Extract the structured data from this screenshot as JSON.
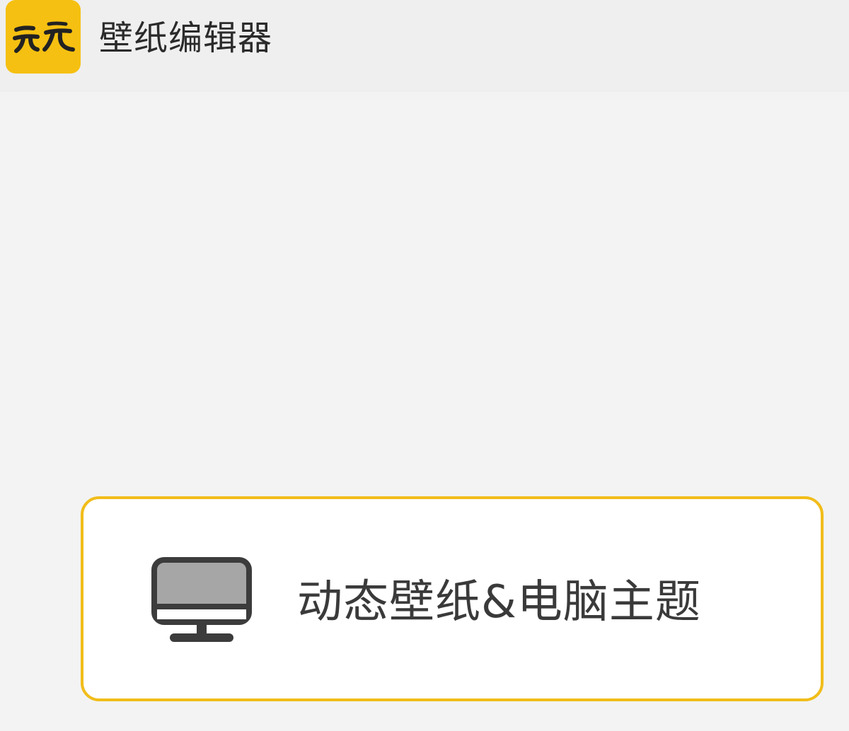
{
  "app": {
    "logo_text": "元气",
    "title": "壁纸编辑器",
    "brand_color": "#f5c011"
  },
  "card": {
    "icon": "monitor-icon",
    "label": "动态壁纸&电脑主题",
    "border_color": "#f1bd1a"
  }
}
